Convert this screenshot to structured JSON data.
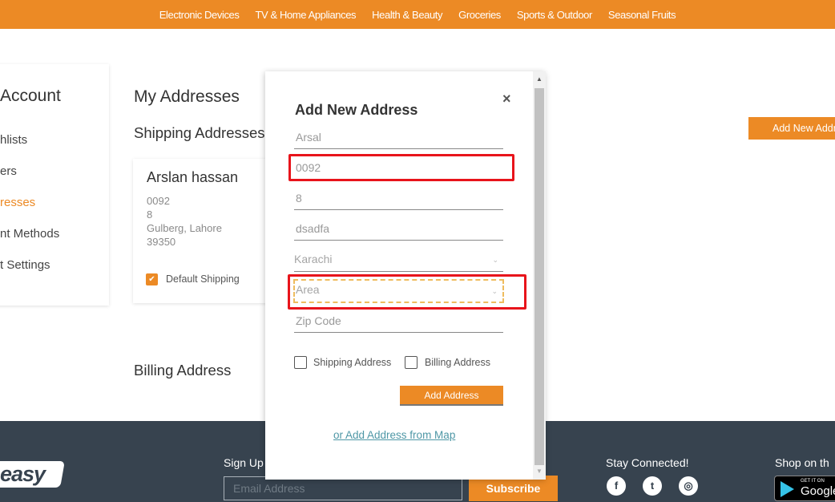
{
  "topnav": {
    "items": [
      "Electronic Devices",
      "TV & Home Appliances",
      "Health & Beauty",
      "Groceries",
      "Sports & Outdoor",
      "Seasonal Fruits"
    ]
  },
  "sidebar": {
    "title": "Account",
    "items": [
      {
        "label": "hlists"
      },
      {
        "label": "ers"
      },
      {
        "label": "resses",
        "active": true
      },
      {
        "label": "nt Methods"
      },
      {
        "label": "t Settings"
      }
    ]
  },
  "main": {
    "page_title": "My Addresses",
    "shipping_title": "Shipping Addresses",
    "billing_title": "Billing Address",
    "add_new_label": "Add New Address",
    "card": {
      "name": "Arslan hassan",
      "lines": [
        "0092",
        "8",
        "Gulberg, Lahore",
        "39350"
      ],
      "default_label": "Default Shipping",
      "default_checked": true
    }
  },
  "modal": {
    "title": "Add New Address",
    "close_icon": "×",
    "fields": {
      "name": {
        "value": "Arsal"
      },
      "phone": {
        "value": "0092"
      },
      "house": {
        "value": "8"
      },
      "street": {
        "value": "dsadfa"
      },
      "city": {
        "value": "Karachi"
      },
      "area": {
        "placeholder": "Area"
      },
      "zip": {
        "placeholder": "Zip Code"
      }
    },
    "shipping_checkbox_label": "Shipping Address",
    "billing_checkbox_label": "Billing Address",
    "submit_label": "Add Address",
    "map_link": "or Add Address from Map"
  },
  "footer": {
    "logo": "easy",
    "signup_label": "Sign Up",
    "email_placeholder": "Email Address",
    "subscribe_label": "Subscribe",
    "stay_connected": "Stay Connected!",
    "shop_on": "Shop on th",
    "social": [
      "f",
      "t",
      "◎"
    ],
    "gplay_small": "GET IT ON",
    "gplay_big": "Google"
  },
  "colors": {
    "accent": "#ec8a25",
    "footer_bg": "#37434f",
    "highlight": "#e8141b",
    "link": "#4e97a6"
  }
}
